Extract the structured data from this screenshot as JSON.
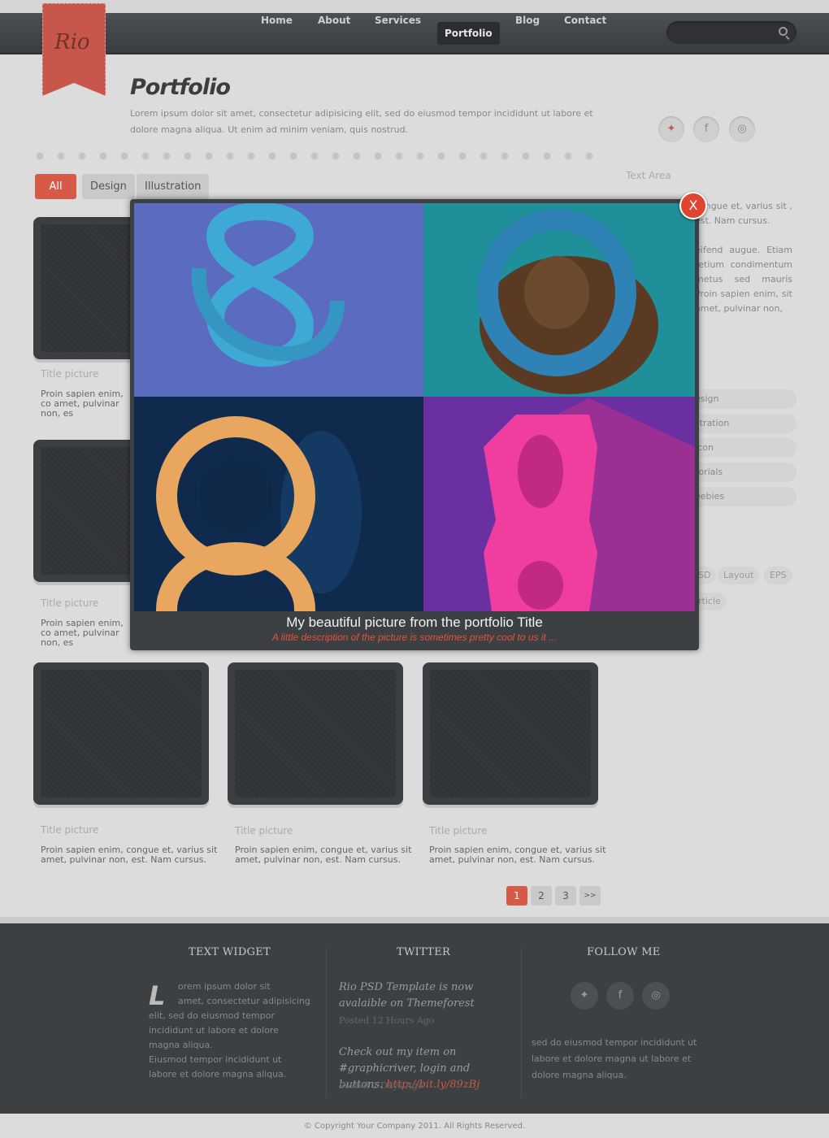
{
  "logo": {
    "text": "Rio"
  },
  "nav": {
    "items": [
      "Home",
      "About",
      "Services",
      "Portfolio",
      "Blog",
      "Contact"
    ],
    "active": "Portfolio"
  },
  "page": {
    "title": "Portfolio",
    "intro": "Lorem ipsum dolor sit amet, consectetur adipisicing elit, sed do eiusmod tempor incididunt ut labore et dolore magna aliqua. Ut enim ad minim veniam, quis nostrud."
  },
  "social_icons": [
    "twitter-icon",
    "facebook-icon",
    "dribbble-icon"
  ],
  "filters": [
    "All",
    "Design",
    "Illustration"
  ],
  "sidebar": {
    "text_area_label": "Text Area",
    "text1": "congue et, varius sit , est. Nam cursus.",
    "text2": "eifend augue. Etiam retium condimentum metus sed mauris Proin sapien enim, sit amet, pulvinar non,",
    "categories": [
      "esign",
      "stration",
      "Icon",
      "torials",
      "eebies"
    ],
    "tags": [
      "SD",
      "Layout",
      "EPS",
      "rticle"
    ]
  },
  "cards": [
    {
      "title": "Title picture",
      "desc": "Proin sapien enim, co amet, pulvinar non, es"
    },
    {
      "title": "Title picture",
      "desc": "Proin sapien enim, co amet, pulvinar non, es"
    },
    {
      "title": "Title picture",
      "desc": "Proin sapien enim, congue et, varius sit amet, pulvinar non, est. Nam cursus."
    },
    {
      "title": "Title picture",
      "desc": "Proin sapien enim, congue et, varius sit amet, pulvinar non, est. Nam cursus."
    },
    {
      "title": "Title picture",
      "desc": "Proin sapien enim, congue et, varius sit amet, pulvinar non, est. Nam cursus."
    }
  ],
  "pagination": {
    "pages": [
      "1",
      "2",
      "3",
      ">>"
    ],
    "current": "1"
  },
  "lightbox": {
    "title": "My beautiful picture from the portfolio Title",
    "description": "A little description of the picture is sometimes pretty cool to us it ...",
    "close_label": "X"
  },
  "footer": {
    "text_widget": {
      "heading": "TEXT WIDGET",
      "dropcap": "L",
      "line1": "orem ipsum dolor sit",
      "line2": "amet, consectetur adipisicing",
      "line3": "elit, sed do eiusmod tempor incididunt ut labore et dolore magna aliqua.",
      "para2": "Eiusmod tempor incididunt ut labore et dolore magna aliqua."
    },
    "twitter": {
      "heading": "TWITTER",
      "tweet1": "Rio PSD Template is now avalaible on Themeforest",
      "posted1": "Posted 12 Hours Ago",
      "tweet2_text": "Check out my item on #graphicriver, login and buttons. ",
      "tweet2_link": "http://bit.ly/89zBj",
      "posted2": "Posted 2 Days Ago"
    },
    "follow": {
      "heading": "FOLLOW ME",
      "text": "sed do eiusmod tempor incididunt ut labore et dolore magna ut labore et dolore magna aliqua."
    },
    "copyright": "© Copyright Your Company 2011. All Rights Reserved."
  },
  "colors": {
    "accent": "#d65a48",
    "dark": "#3d4043",
    "background": "#dcdcdc"
  }
}
